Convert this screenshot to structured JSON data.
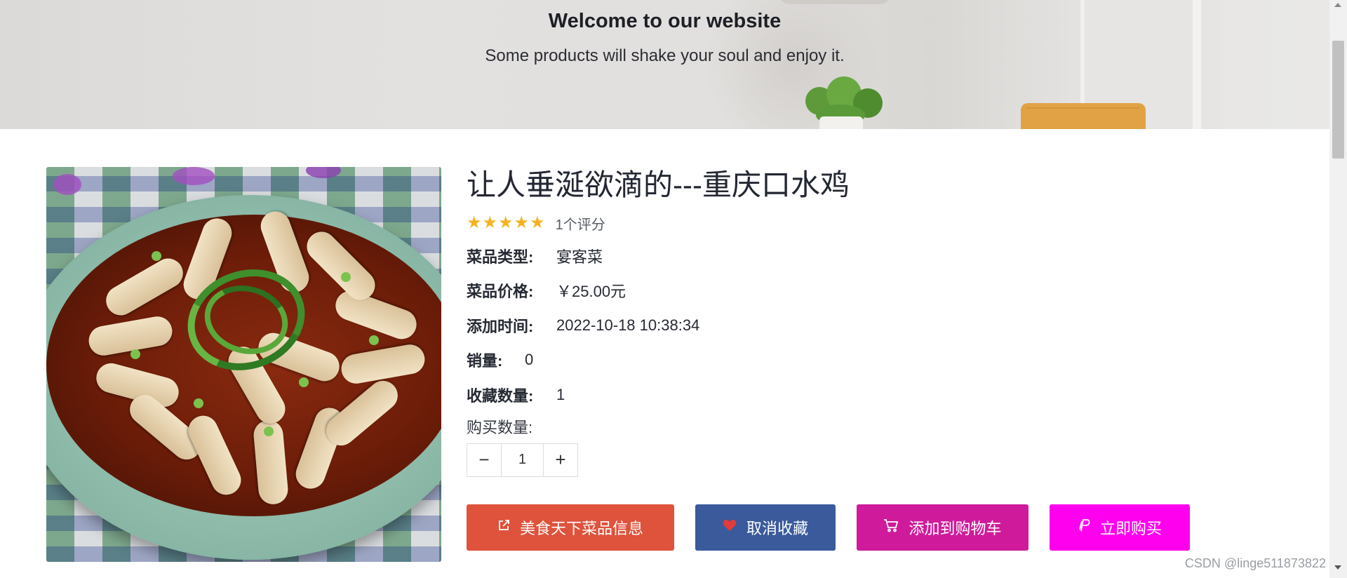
{
  "hero": {
    "title": "Welcome to our website",
    "subtitle": "Some products will shake your soul and enjoy it."
  },
  "product": {
    "title": "让人垂涎欲滴的---重庆口水鸡",
    "rating": 5,
    "rating_max": 5,
    "review_count": "1个评分",
    "details": [
      {
        "label": "菜品类型:",
        "value": "宴客菜"
      },
      {
        "label": "菜品价格:",
        "value": "￥25.00元"
      },
      {
        "label": "添加时间:",
        "value": "2022-10-18 10:38:34"
      },
      {
        "label": "销量:",
        "value": "0"
      },
      {
        "label": "收藏数量:",
        "value": "1"
      }
    ],
    "quantity_label": "购买数量:",
    "quantity": "1"
  },
  "actions": {
    "info_label": "美食天下菜品信息",
    "unfavorite_label": "取消收藏",
    "add_to_cart_label": "添加到购物车",
    "buy_now_label": "立即购买"
  },
  "icons": {
    "info": "external-link-icon",
    "unfavorite": "heart-icon",
    "add_to_cart": "cart-icon",
    "buy_now": "paypal-icon",
    "decrease": "minus-icon",
    "increase": "plus-icon"
  },
  "colors": {
    "info_button": "#df523b",
    "unfavorite_button": "#3a5a9c",
    "cart_button": "#cf1b9b",
    "buy_button": "#ff00ee",
    "star": "#f3b321"
  },
  "watermark": "CSDN @linge511873822"
}
